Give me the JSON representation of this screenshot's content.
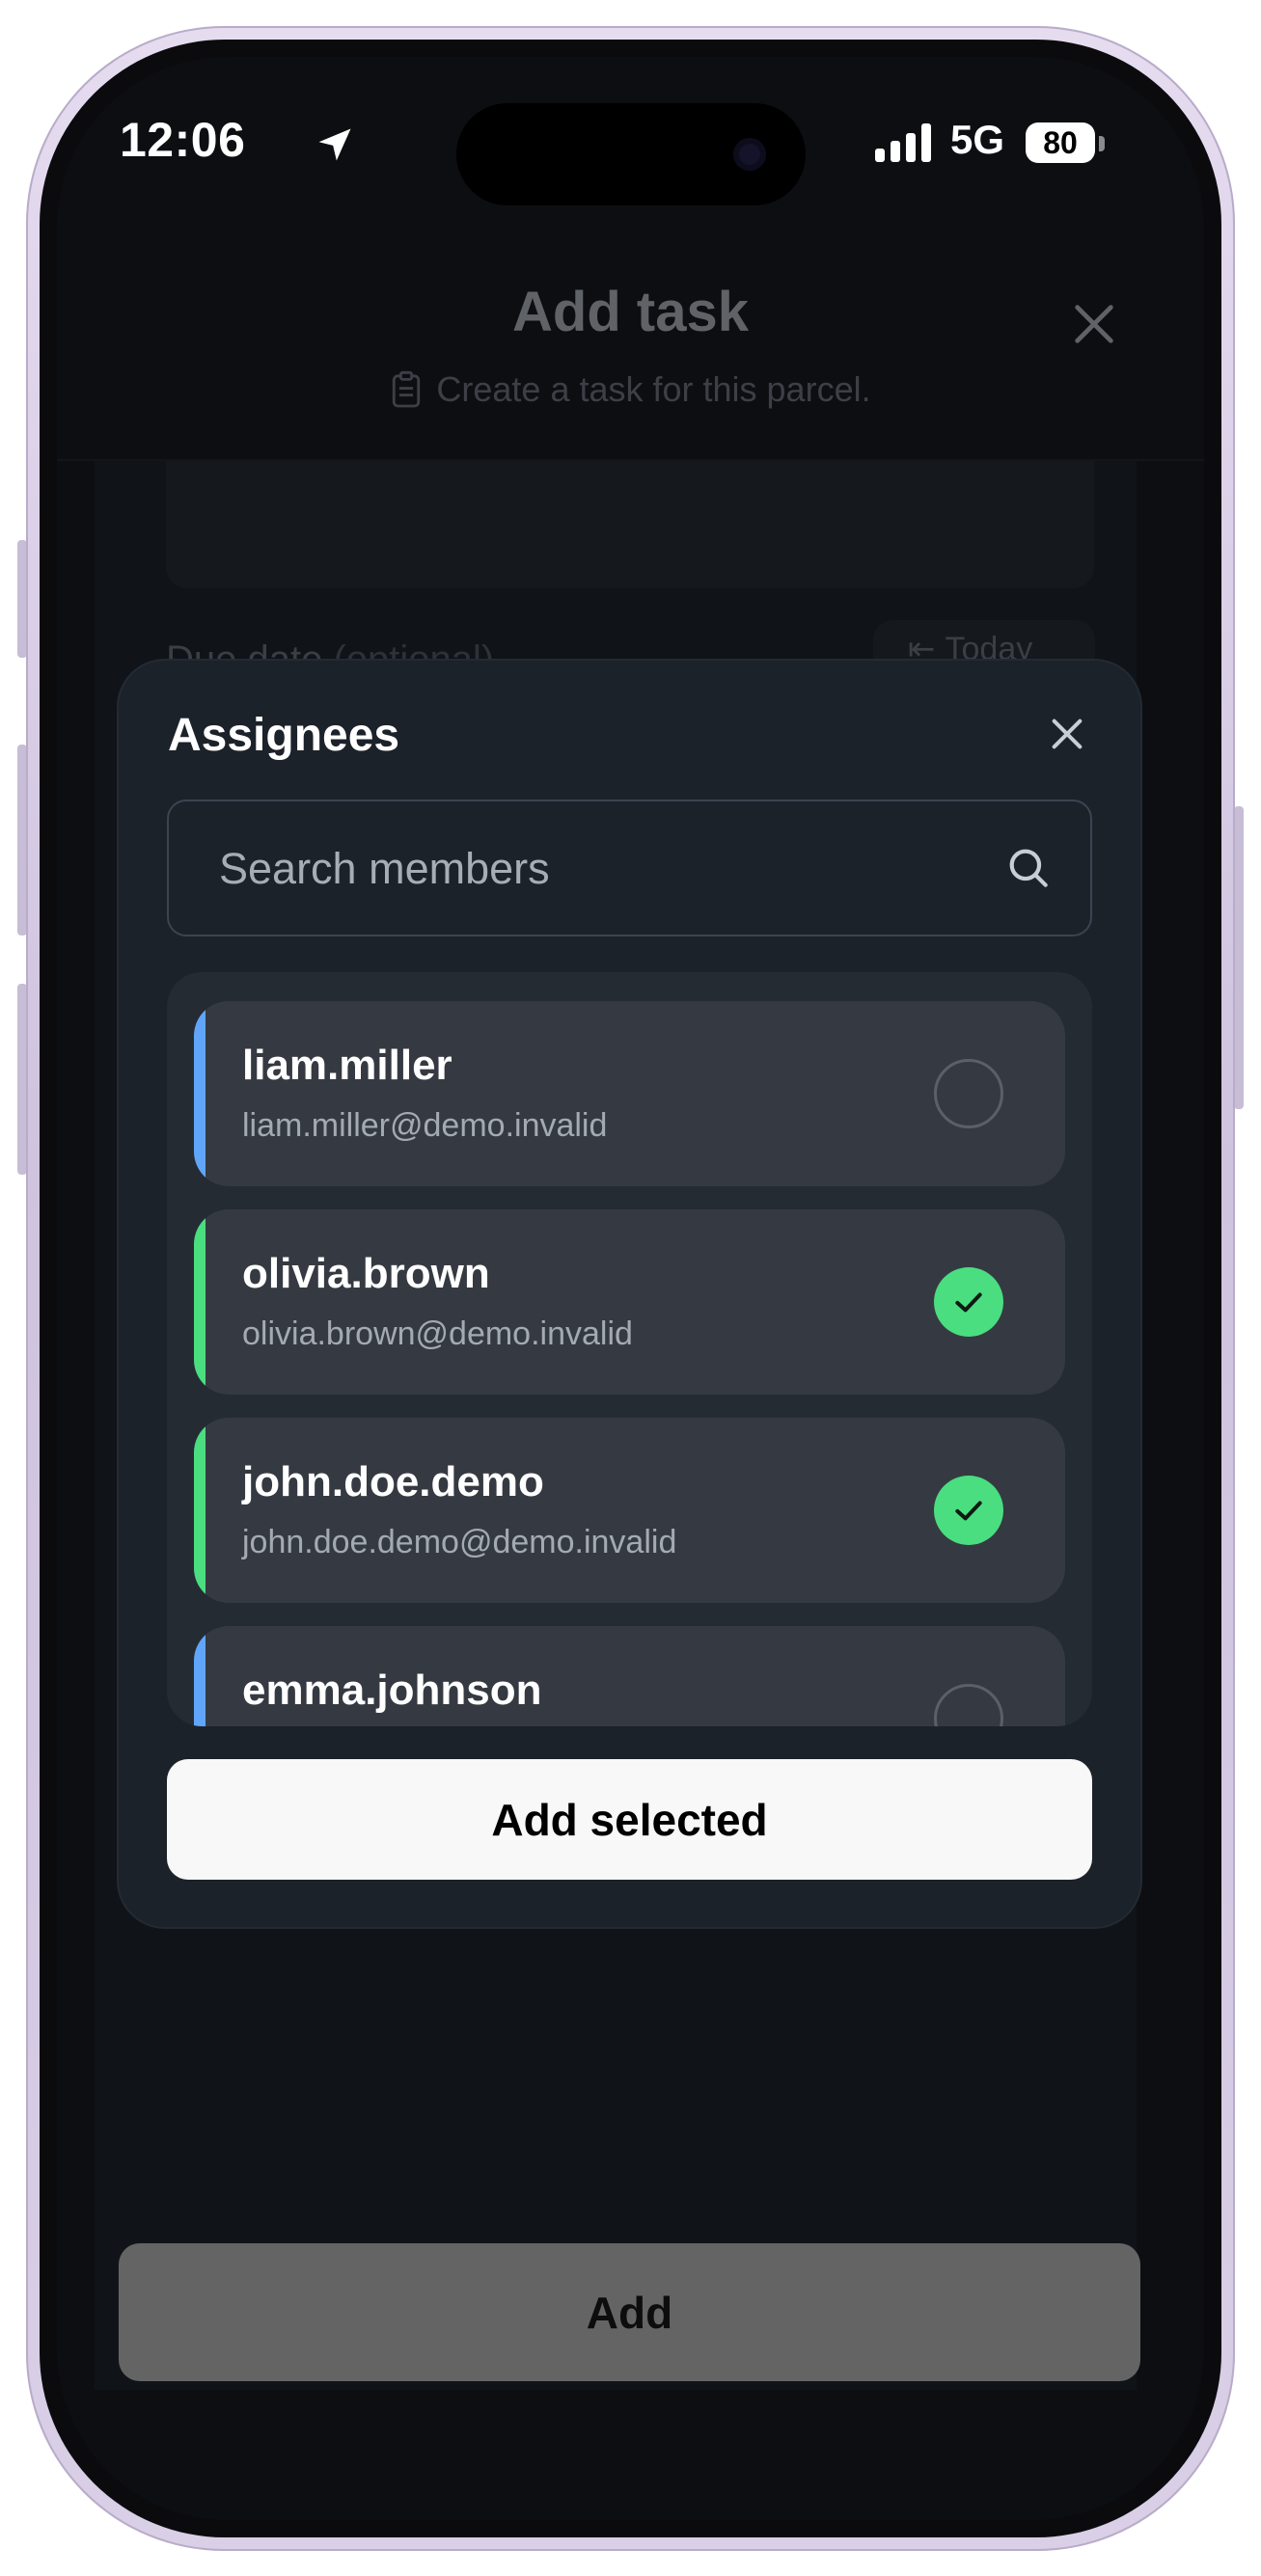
{
  "status_bar": {
    "time": "12:06",
    "network": "5G",
    "battery": "80"
  },
  "background_page": {
    "title": "Add task",
    "subtitle": "Create a task for this parcel.",
    "due_label": "Due date",
    "due_optional": "(optional)",
    "today_label": "Today"
  },
  "assignees_modal": {
    "title": "Assignees",
    "search": {
      "placeholder": "Search members",
      "value": ""
    },
    "members": [
      {
        "name": "liam.miller",
        "email": "liam.miller@demo.invalid",
        "selected": false,
        "accent": "#60a5fa"
      },
      {
        "name": "olivia.brown",
        "email": "olivia.brown@demo.invalid",
        "selected": true,
        "accent": "#4ade80"
      },
      {
        "name": "john.doe.demo",
        "email": "john.doe.demo@demo.invalid",
        "selected": true,
        "accent": "#4ade80"
      },
      {
        "name": "emma.johnson",
        "email": "",
        "selected": false,
        "accent": "#60a5fa"
      }
    ],
    "add_selected_label": "Add selected"
  },
  "footer": {
    "add_label": "Add"
  },
  "colors": {
    "selected_check": "#4ade80",
    "accent_blue": "#60a5fa",
    "modal_bg": "#1c222a",
    "card_bg": "#353a42"
  }
}
